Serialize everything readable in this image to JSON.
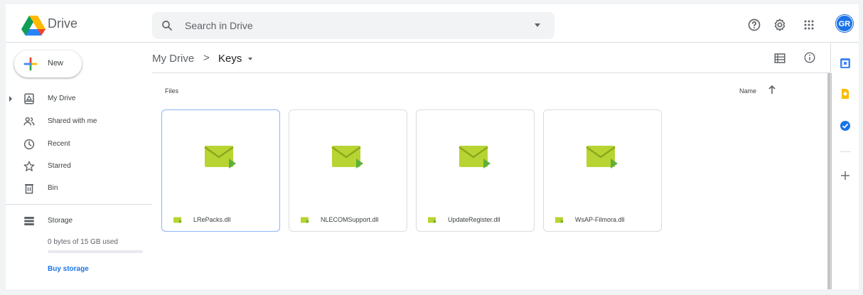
{
  "header": {
    "brand": "Drive",
    "search_placeholder": "Search in Drive",
    "avatar_initials": "GR"
  },
  "sidebar": {
    "new_label": "New",
    "items": [
      {
        "label": "My Drive",
        "icon": "my-drive-icon"
      },
      {
        "label": "Shared with me",
        "icon": "shared-icon"
      },
      {
        "label": "Recent",
        "icon": "clock-icon"
      },
      {
        "label": "Starred",
        "icon": "star-icon"
      },
      {
        "label": "Bin",
        "icon": "bin-icon"
      }
    ],
    "storage_label": "Storage",
    "storage_used": "0 bytes of 15 GB used",
    "storage_fraction": 0,
    "buy_storage": "Buy storage"
  },
  "breadcrumb": {
    "root": "My Drive",
    "separator": ">",
    "current": "Keys"
  },
  "files": {
    "section_label": "Files",
    "sort_label": "Name",
    "items": [
      {
        "name": "LRePacks.dll",
        "selected": true
      },
      {
        "name": "NLECOMSupport.dll",
        "selected": false
      },
      {
        "name": "UpdateRegister.dll",
        "selected": false
      },
      {
        "name": "WsAP-Filmora.dll",
        "selected": false
      }
    ]
  },
  "colors": {
    "accent": "#1a73e8",
    "file_green": "#b8d432",
    "file_green_dark": "#5fb03a",
    "selected_border": "#8ab4f8"
  }
}
